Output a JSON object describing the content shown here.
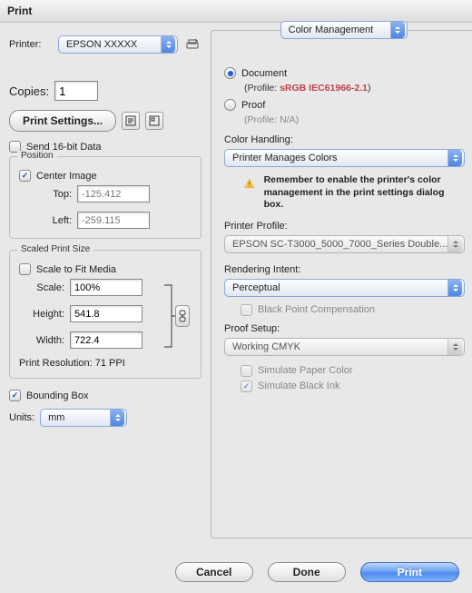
{
  "window": {
    "title": "Print"
  },
  "left": {
    "printer_label": "Printer:",
    "printer_value": "EPSON XXXXX",
    "copies_label": "Copies:",
    "copies_value": "1",
    "print_settings_btn": "Print Settings...",
    "send16_label": "Send 16-bit Data",
    "position": {
      "legend": "Position",
      "center_label": "Center Image",
      "top_label": "Top:",
      "top_value": "-125.412",
      "left_label": "Left:",
      "left_value": "-259.115"
    },
    "scaled": {
      "legend": "Scaled Print Size",
      "fit_label": "Scale to Fit Media",
      "scale_label": "Scale:",
      "scale_value": "100%",
      "height_label": "Height:",
      "height_value": "541.8",
      "width_label": "Width:",
      "width_value": "722.4",
      "resolution_label": "Print Resolution: 71 PPI"
    },
    "bounding_label": "Bounding Box",
    "units_label": "Units:",
    "units_value": "mm"
  },
  "right": {
    "panel_select": "Color Management",
    "document_label": "Document",
    "document_profile_prefix": "(Profile: ",
    "document_profile_value": "sRGB IEC61966-2.1",
    "document_profile_suffix": ")",
    "proof_label": "Proof",
    "proof_profile": "(Profile: N/A)",
    "color_handling_label": "Color Handling:",
    "color_handling_value": "Printer Manages Colors",
    "warning_text": "Remember to enable the printer's color management in the print settings dialog box.",
    "printer_profile_label": "Printer Profile:",
    "printer_profile_value": "EPSON SC-T3000_5000_7000_Series Double...",
    "rendering_label": "Rendering Intent:",
    "rendering_value": "Perceptual",
    "bpc_label": "Black Point Compensation",
    "proof_setup_label": "Proof Setup:",
    "proof_setup_value": "Working CMYK",
    "sim_paper_label": "Simulate Paper Color",
    "sim_black_label": "Simulate Black Ink"
  },
  "buttons": {
    "cancel": "Cancel",
    "done": "Done",
    "print": "Print"
  }
}
